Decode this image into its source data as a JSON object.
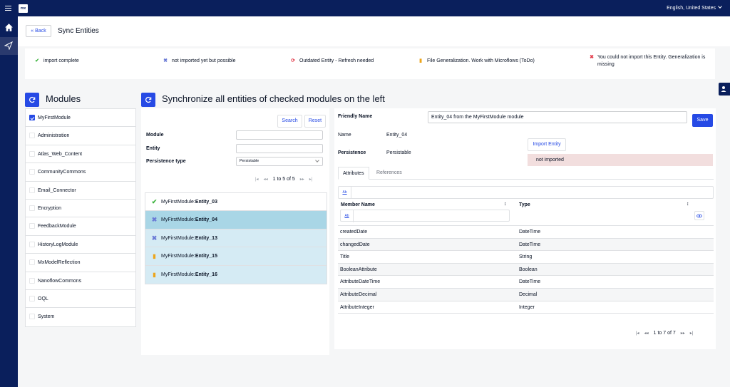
{
  "topbar": {
    "logo": "mx",
    "language": "English, United States"
  },
  "header": {
    "back_label": "Back",
    "title": "Sync Entities"
  },
  "legend": [
    {
      "icon": "check-icon",
      "color": "#3cb33d",
      "glyph": "✔",
      "text": "import complete"
    },
    {
      "icon": "cross-icon",
      "color": "#6b7bd6",
      "glyph": "✖",
      "text": "not imported yet but possible"
    },
    {
      "icon": "refresh-icon",
      "color": "#e33f4e",
      "glyph": "⟳",
      "text": "Outdated Entity - Refresh needed"
    },
    {
      "icon": "file-icon",
      "color": "#eca51c",
      "glyph": "▮",
      "text": "File Generalization. Work with Microflows (ToDo)"
    },
    {
      "icon": "cross-icon",
      "color": "#e33f4e",
      "glyph": "✖",
      "text": "You could not import this Entity. Generalization is missing"
    }
  ],
  "modules": {
    "title": "Modules",
    "items": [
      {
        "label": "MyFirstModule",
        "checked": true
      },
      {
        "label": "Administration",
        "checked": false
      },
      {
        "label": "Atlas_Web_Content",
        "checked": false
      },
      {
        "label": "CommunityCommons",
        "checked": false
      },
      {
        "label": "Email_Connector",
        "checked": false
      },
      {
        "label": "Encryption",
        "checked": false
      },
      {
        "label": "FeedbackModule",
        "checked": false
      },
      {
        "label": "HistoryLogModule",
        "checked": false
      },
      {
        "label": "MxModelReflection",
        "checked": false
      },
      {
        "label": "NanoflowCommons",
        "checked": false
      },
      {
        "label": "OQL",
        "checked": false
      },
      {
        "label": "System",
        "checked": false
      }
    ]
  },
  "sync": {
    "title": "Synchronize all entities of checked modules on the left"
  },
  "search": {
    "search_label": "Search",
    "reset_label": "Reset",
    "module_label": "Module",
    "module_value": "",
    "entity_label": "Entity",
    "entity_value": "",
    "ptype_label": "Persistence type",
    "ptype_value": "Persistable",
    "pager": "1 to 5 of 5"
  },
  "entities": [
    {
      "module": "MyFirstModule:",
      "name": "Entity_03",
      "status": "check",
      "color": "#3cb33d"
    },
    {
      "module": "MyFirstModule:",
      "name": "Entity_04",
      "status": "cross",
      "color": "#6b7bd6",
      "selected": true
    },
    {
      "module": "MyFirstModule:",
      "name": "Entity_13",
      "status": "cross",
      "color": "#6b7bd6"
    },
    {
      "module": "MyFirstModule:",
      "name": "Entity_15",
      "status": "file",
      "color": "#eca51c"
    },
    {
      "module": "MyFirstModule:",
      "name": "Entity_16",
      "status": "file",
      "color": "#eca51c"
    }
  ],
  "detail": {
    "friendly_label": "Friendly Name",
    "friendly_value": "Entity_04 from the MyFirstModule module",
    "save_label": "Save",
    "name_label": "Name",
    "name_value": "Entity_04",
    "persistence_label": "Persistence",
    "persistence_value": "Persistable",
    "import_label": "Import Entity",
    "status_text": "not imported",
    "tabs": [
      "Attributes",
      "References"
    ],
    "ab_label": "Ab",
    "columns": [
      "Member Name",
      "Type"
    ],
    "rows": [
      {
        "name": "createdDate",
        "type": "DateTime"
      },
      {
        "name": "changedDate",
        "type": "DateTime"
      },
      {
        "name": "Title",
        "type": "String"
      },
      {
        "name": "BooleanAttribute",
        "type": "Boolean"
      },
      {
        "name": "AttributeDateTime",
        "type": "DateTime"
      },
      {
        "name": "AttributeDecimal",
        "type": "Decimal"
      },
      {
        "name": "AttributeInteger",
        "type": "Integer"
      }
    ],
    "pager": "1 to 7 of 7"
  }
}
